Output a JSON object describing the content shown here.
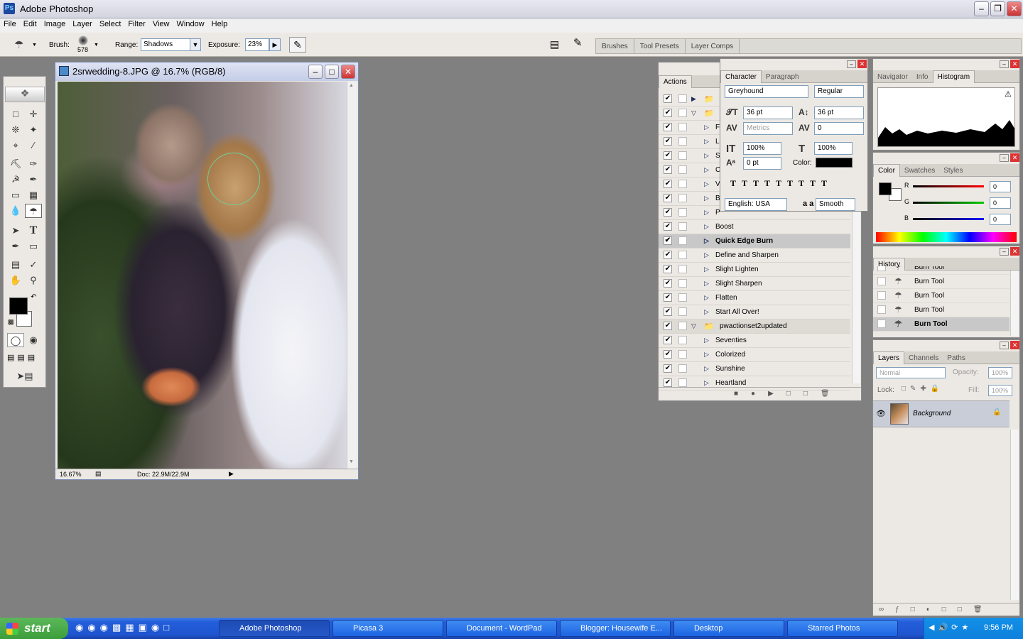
{
  "app": {
    "title": "Adobe Photoshop"
  },
  "menu": [
    "File",
    "Edit",
    "Image",
    "Layer",
    "Select",
    "Filter",
    "View",
    "Window",
    "Help"
  ],
  "options": {
    "brush_label": "Brush:",
    "brush_size": "578",
    "range_label": "Range:",
    "range_value": "Shadows",
    "exposure_label": "Exposure:",
    "exposure_value": "23%"
  },
  "well_tabs": [
    "Brushes",
    "Tool Presets",
    "Layer Comps"
  ],
  "document": {
    "title": "2srwedding-8.JPG @ 16.7% (RGB/8)",
    "zoom": "16.67%",
    "doc_size": "Doc: 22.9M/22.9M"
  },
  "actions": {
    "tab": "Actions",
    "rows": [
      {
        "label": "",
        "type": "folder"
      },
      {
        "label": "",
        "type": "folder-open"
      },
      {
        "label": "F",
        "type": "action"
      },
      {
        "label": "L",
        "type": "action"
      },
      {
        "label": "S",
        "type": "action"
      },
      {
        "label": "C",
        "type": "action"
      },
      {
        "label": "V",
        "type": "action"
      },
      {
        "label": "B",
        "type": "action"
      },
      {
        "label": "P",
        "type": "action"
      },
      {
        "label": "Boost",
        "type": "action"
      },
      {
        "label": "Quick Edge Burn",
        "type": "action-selected"
      },
      {
        "label": "Define and Sharpen",
        "type": "action"
      },
      {
        "label": "Slight Lighten",
        "type": "action"
      },
      {
        "label": "Slight Sharpen",
        "type": "action"
      },
      {
        "label": "Flatten",
        "type": "action"
      },
      {
        "label": "Start All Over!",
        "type": "action"
      },
      {
        "label": "pwactionset2updated",
        "type": "set"
      },
      {
        "label": "Seventies",
        "type": "action"
      },
      {
        "label": "Colorized",
        "type": "action"
      },
      {
        "label": "Sunshine",
        "type": "action"
      },
      {
        "label": "Heartland",
        "type": "action"
      }
    ]
  },
  "character": {
    "tabs": [
      "Character",
      "Paragraph"
    ],
    "font": "Greyhound",
    "style": "Regular",
    "size": "36 pt",
    "leading": "36 pt",
    "kerning": "Metrics",
    "tracking": "0",
    "vscale": "100%",
    "hscale": "100%",
    "baseline": "0 pt",
    "color_label": "Color:",
    "language": "English: USA",
    "antialias": "Smooth",
    "aa_label": "a a"
  },
  "histogram": {
    "tabs": [
      "Navigator",
      "Info",
      "Histogram"
    ]
  },
  "color": {
    "tabs": [
      "Color",
      "Swatches",
      "Styles"
    ],
    "r": "0",
    "g": "0",
    "b": "0",
    "r_label": "R",
    "g_label": "G",
    "b_label": "B"
  },
  "history": {
    "tab": "History",
    "items": [
      "Burn Tool",
      "Burn Tool",
      "Burn Tool",
      "Burn Tool",
      "Burn Tool"
    ]
  },
  "layers": {
    "tabs": [
      "Layers",
      "Channels",
      "Paths"
    ],
    "blend": "Normal",
    "opacity_label": "Opacity:",
    "opacity": "100%",
    "lock_label": "Lock:",
    "fill_label": "Fill:",
    "fill": "100%",
    "layer_name": "Background"
  },
  "taskbar": {
    "start": "start",
    "tasks": [
      "Adobe Photoshop",
      "Picasa 3",
      "Document - WordPad",
      "Blogger: Housewife E...",
      "Desktop",
      "Starred Photos"
    ],
    "clock": "9:56 PM"
  }
}
